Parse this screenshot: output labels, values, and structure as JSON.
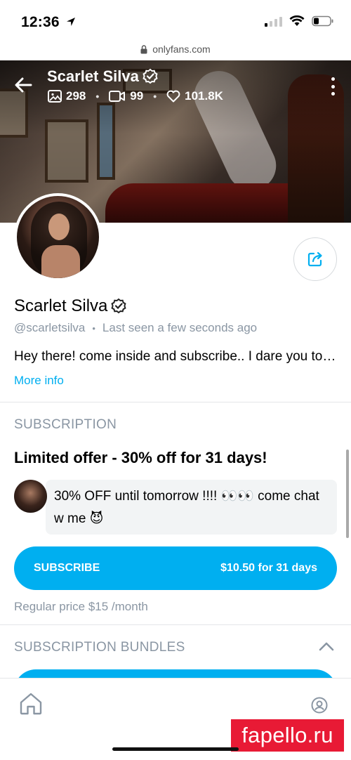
{
  "status_bar": {
    "time": "12:36"
  },
  "browser": {
    "url": "onlyfans.com"
  },
  "cover": {
    "name": "Scarlet Silva",
    "stats": {
      "photos": "298",
      "videos": "99",
      "likes": "101.8K"
    }
  },
  "profile": {
    "name": "Scarlet Silva",
    "handle": "@scarletsilva",
    "separator": "•",
    "last_seen": "Last seen a few seconds ago",
    "bio": "Hey there! come inside and subscribe.. I dare you to come chat w me",
    "more_info": "More info"
  },
  "subscription": {
    "section_title": "SUBSCRIPTION",
    "offer_title": "Limited offer - 30% off for 31 days!",
    "promo_message": "30% OFF until tomorrow !!!! 👀👀 come chat w me 😈",
    "subscribe_label": "SUBSCRIBE",
    "subscribe_price": "$10.50 for 31 days",
    "regular_price": "Regular price $15 /month"
  },
  "bundles": {
    "section_title": "SUBSCRIPTION BUNDLES"
  },
  "watermark": {
    "text": "fapello.ru"
  },
  "colors": {
    "accent": "#00aff0",
    "muted": "#8a96a3",
    "watermark": "#e81a35"
  },
  "icons": {
    "back": "arrow-left-icon",
    "photos": "image-icon",
    "videos": "video-icon",
    "likes": "heart-icon",
    "more": "vertical-dots-icon",
    "verified": "verified-badge-icon",
    "share": "share-icon",
    "chevron": "chevron-up-icon",
    "home": "home-icon",
    "profile": "user-circle-icon"
  }
}
